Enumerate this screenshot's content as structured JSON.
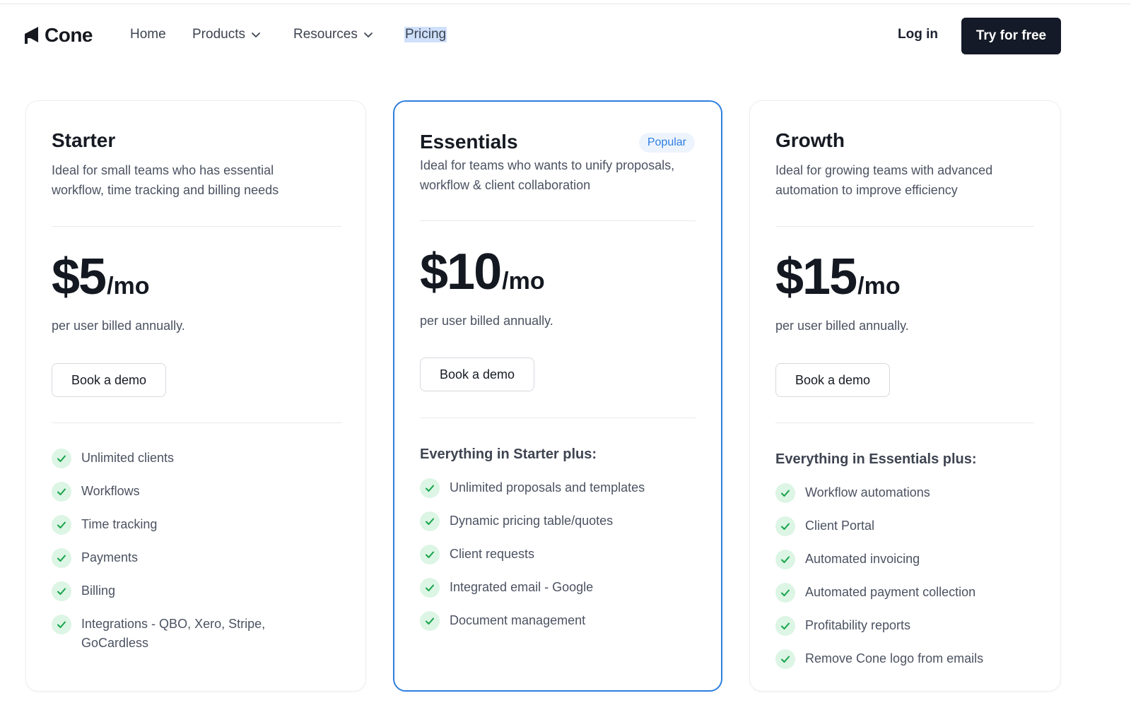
{
  "brand": {
    "name": "Cone",
    "icon": "cone-logo-icon"
  },
  "nav": {
    "home": "Home",
    "products": "Products",
    "resources": "Resources",
    "pricing": "Pricing",
    "login": "Log in",
    "cta": "Try for free"
  },
  "colors": {
    "accent": "#2f7fe0",
    "cta_bg": "#141a27",
    "check_bg": "#dcf5e4",
    "check": "#16a34a"
  },
  "plans": [
    {
      "name": "Starter",
      "description": "Ideal for small teams who has essential workflow, time tracking and billing needs",
      "price": "$5",
      "period": "/mo",
      "billing": "per user billed annually.",
      "button": "Book a demo",
      "features_heading": "",
      "features": [
        "Unlimited clients",
        "Workflows",
        "Time tracking",
        "Payments",
        "Billing",
        "Integrations - QBO, Xero, Stripe, GoCardless"
      ]
    },
    {
      "name": "Essentials",
      "badge": "Popular",
      "description": "Ideal for teams who wants to unify proposals, workflow & client collaboration",
      "price": "$10",
      "period": "/mo",
      "billing": "per user billed annually.",
      "button": "Book a demo",
      "features_heading": "Everything in Starter plus:",
      "features": [
        "Unlimited proposals and templates",
        "Dynamic pricing table/quotes",
        "Client requests",
        "Integrated email - Google",
        "Document management"
      ]
    },
    {
      "name": "Growth",
      "description": "Ideal for growing teams with advanced automation to improve efficiency",
      "price": "$15",
      "period": "/mo",
      "billing": "per user billed annually.",
      "button": "Book a demo",
      "features_heading": "Everything in Essentials plus:",
      "features": [
        "Workflow automations",
        "Client Portal",
        "Automated invoicing",
        "Automated payment collection",
        "Profitability reports",
        "Remove Cone logo from emails"
      ]
    }
  ]
}
